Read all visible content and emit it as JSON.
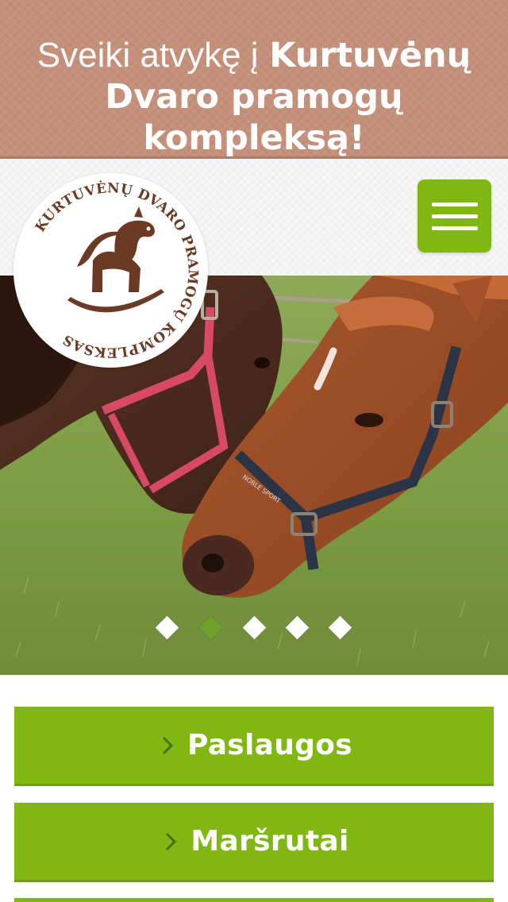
{
  "banner": {
    "greeting_light": "Sveiki atvykę į",
    "greeting_bold_1": "Kurtuvėnų",
    "greeting_bold_2": "Dvaro pramogų kompleksą!"
  },
  "logo": {
    "text_top": "KURTUVĖNŲ DVARO PRAMOGŲ KOMPLEKSAS",
    "icon": "rocking-horse-icon"
  },
  "menu": {
    "icon": "hamburger-icon"
  },
  "slider": {
    "slide_count": 5,
    "active_index": 1
  },
  "nav": {
    "items": [
      {
        "label": "Paslaugos",
        "icon": "chevron-right-icon"
      },
      {
        "label": "Maršrutai",
        "icon": "chevron-right-icon"
      }
    ]
  },
  "colors": {
    "banner_bg": "#c4907a",
    "accent_green": "#80b713",
    "logo_brown": "#6b3a24"
  }
}
